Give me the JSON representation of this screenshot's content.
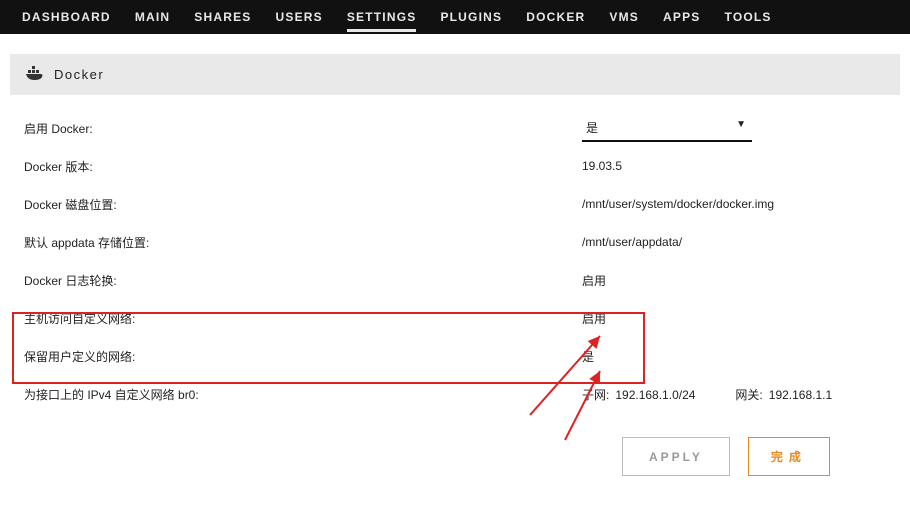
{
  "nav": {
    "items": [
      {
        "label": "DASHBOARD"
      },
      {
        "label": "MAIN"
      },
      {
        "label": "SHARES"
      },
      {
        "label": "USERS"
      },
      {
        "label": "SETTINGS",
        "active": true
      },
      {
        "label": "PLUGINS"
      },
      {
        "label": "DOCKER"
      },
      {
        "label": "VMS"
      },
      {
        "label": "APPS"
      },
      {
        "label": "TOOLS"
      }
    ]
  },
  "section": {
    "title": "Docker"
  },
  "settings": {
    "enable_docker_label": "启用 Docker:",
    "enable_docker_value": "是",
    "version_label": "Docker 版本:",
    "version_value": "19.03.5",
    "vdisk_label": "Docker 磁盘位置:",
    "vdisk_value": "/mnt/user/system/docker/docker.img",
    "appdata_label": "默认 appdata 存储位置:",
    "appdata_value": "/mnt/user/appdata/",
    "logrotate_label": "Docker 日志轮换:",
    "logrotate_value": "启用",
    "host_access_label": "主机访问自定义网络:",
    "host_access_value": "启用",
    "preserve_net_label": "保留用户定义的网络:",
    "preserve_net_value": "是",
    "ipv4_label": "为接口上的 IPv4 自定义网络 br0:",
    "subnet_label": "子网:",
    "subnet_value": "192.168.1.0/24",
    "gateway_label": "网关:",
    "gateway_value": "192.168.1.1"
  },
  "actions": {
    "apply": "APPLY",
    "done": "完成"
  }
}
